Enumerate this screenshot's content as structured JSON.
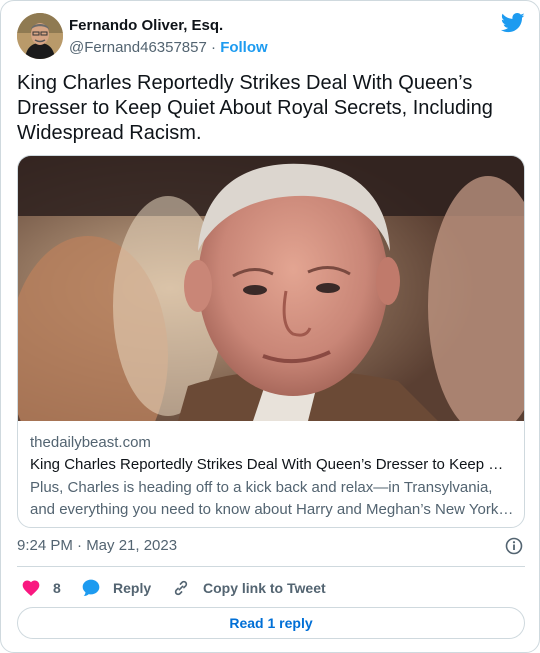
{
  "user": {
    "display_name": "Fernando Oliver, Esq.",
    "handle": "@Fernand46357857",
    "separator": " · ",
    "follow_label": "Follow"
  },
  "tweet": {
    "text": "King Charles Reportedly Strikes Deal With Queen’s Dresser to Keep Quiet About Royal Secrets, Including Widespread Racism.",
    "timestamp": "9:24 PM · May 21, 2023"
  },
  "link_card": {
    "domain": "thedailybeast.com",
    "title": "King Charles Reportedly Strikes Deal With Queen’s Dresser to Keep Quiet About Royal Secrets",
    "description": "Plus, Charles is heading off to a kick back and relax—in Transylvania, and everything you need to know about Harry and Meghan’s New York car chase."
  },
  "actions": {
    "like_count": "8",
    "reply_label": "Reply",
    "copy_label": "Copy link to Tweet"
  },
  "read_reply_label": "Read 1 reply",
  "icons": {
    "brand": "twitter-bird-icon",
    "info": "info-icon",
    "like": "heart-icon",
    "reply": "speech-bubble-icon",
    "copy": "link-icon"
  },
  "colors": {
    "accent": "#1d9bf0",
    "like": "#f91880",
    "text": "#0f1419",
    "muted": "#536471",
    "border": "#cfd9de"
  }
}
